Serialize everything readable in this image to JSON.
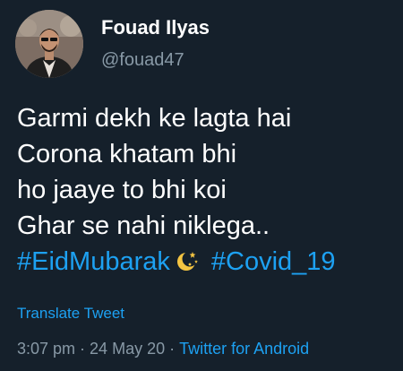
{
  "author": {
    "display_name": "Fouad Ilyas",
    "handle": "@fouad47"
  },
  "tweet": {
    "lines": [
      "Garmi dekh ke lagta hai",
      "Corona khatam bhi",
      "ho jaaye to bhi koi",
      "Ghar se nahi niklega.."
    ],
    "hashtags": [
      "#EidMubarak",
      "#Covid_19"
    ],
    "emoji_icon": "crescent-moon-stars-icon"
  },
  "translate_label": "Translate Tweet",
  "meta": {
    "time": "3:07 pm",
    "separator": "·",
    "date": "24 May 20",
    "source": "Twitter for Android"
  },
  "colors": {
    "background": "#15202b",
    "text": "#ffffff",
    "secondary": "#8899a6",
    "accent": "#1da1f2"
  }
}
